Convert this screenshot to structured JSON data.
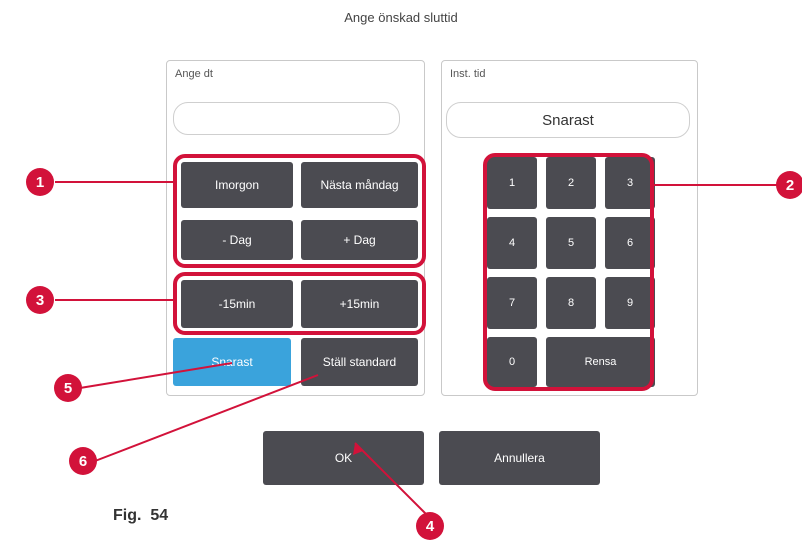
{
  "dialog": {
    "title": "Ange önskad sluttid"
  },
  "left_panel": {
    "label": "Ange dt",
    "input_value": "",
    "buttons": {
      "imorgon": "Imorgon",
      "nasta_mandag": "Nästa måndag",
      "minus_dag": "- Dag",
      "plus_dag": "+ Dag",
      "minus_15": "-15min",
      "plus_15": "+15min",
      "snarast": "Snarast",
      "stall_standard": "Ställ standard"
    }
  },
  "right_panel": {
    "label": "Inst. tid",
    "value": "Snarast",
    "keys": [
      "1",
      "2",
      "3",
      "4",
      "5",
      "6",
      "7",
      "8",
      "9",
      "0"
    ],
    "clear": "Rensa"
  },
  "footer": {
    "ok": "OK",
    "cancel": "Annullera"
  },
  "callouts": {
    "c1": "1",
    "c2": "2",
    "c3": "3",
    "c4": "4",
    "c5": "5",
    "c6": "6"
  },
  "caption": "Fig.  54",
  "colors": {
    "highlight": "#d2123a",
    "button": "#4b4b51",
    "active": "#3aa3dc"
  }
}
